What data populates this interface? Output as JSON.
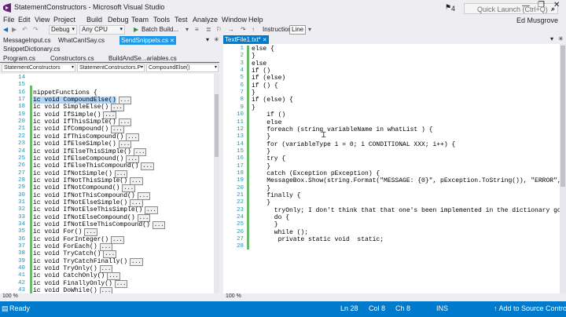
{
  "window": {
    "title": "StatementConstructors - Microsoft Visual Studio",
    "notification_count": "4",
    "quick_launch_placeholder": "Quick Launch (Ctrl+Q)",
    "user": "Ed Musgrove"
  },
  "menu": [
    "File",
    "Edit",
    "View",
    "Project",
    "Build",
    "Debug",
    "Team",
    "Tools",
    "Test",
    "Analyze",
    "Window",
    "Help"
  ],
  "toolbar": {
    "config": "Debug",
    "platform": "Any CPU",
    "batch_build": "Batch Build...",
    "instruction": "Instruction",
    "line": "Line"
  },
  "tabs_row1": [
    {
      "label": "MessageInput.cs"
    },
    {
      "label": "WhatCanISay.cs"
    },
    {
      "label": "SendSnippets.cs"
    }
  ],
  "tabs_row2": [
    {
      "label": "SnippetDictionary.cs"
    }
  ],
  "tabs_row3": [
    {
      "label": "Program.cs"
    },
    {
      "label": "Constructors.cs"
    },
    {
      "label": "BuildAndSe...ariables.cs"
    }
  ],
  "right_tab": {
    "label": "TextFile1.txt*"
  },
  "left_nav": {
    "project": "StatementConstructors",
    "class": "StatementConstructors.P",
    "member": "CompoundElse()"
  },
  "left_code": [
    {
      "n": "14",
      "text": "",
      "tag": ""
    },
    {
      "n": "15",
      "text": "",
      "tag": ""
    },
    {
      "n": "16",
      "text": "nippetFunctions {",
      "tag": ""
    },
    {
      "n": "17",
      "text": "ic void CompoundElse()",
      "tag": "..."
    },
    {
      "n": "18",
      "text": "ic void SimpleElse()",
      "tag": "..."
    },
    {
      "n": "19",
      "text": "ic void IfSimple()",
      "tag": "..."
    },
    {
      "n": "20",
      "text": "ic void IfThisSimple()",
      "tag": "..."
    },
    {
      "n": "21",
      "text": "ic void IfCompound()",
      "tag": "..."
    },
    {
      "n": "22",
      "text": "ic void IfThisCompound()",
      "tag": "..."
    },
    {
      "n": "23",
      "text": "ic void IfElseSimple()",
      "tag": "..."
    },
    {
      "n": "24",
      "text": "ic void IfElseThisSimple()",
      "tag": "..."
    },
    {
      "n": "25",
      "text": "ic void IfElseCompound()",
      "tag": "..."
    },
    {
      "n": "26",
      "text": "ic void IfElseThisCompound()",
      "tag": "..."
    },
    {
      "n": "27",
      "text": "ic void IfNotSimple()",
      "tag": "..."
    },
    {
      "n": "28",
      "text": "ic void IfNotThisSimple()",
      "tag": "..."
    },
    {
      "n": "29",
      "text": "ic void IfNotCompound()",
      "tag": "..."
    },
    {
      "n": "30",
      "text": "ic void IfNotThisCompound()",
      "tag": "..."
    },
    {
      "n": "31",
      "text": "ic void IfNotElseSimple()",
      "tag": "..."
    },
    {
      "n": "32",
      "text": "ic void IfNotElseThisSimple()",
      "tag": "..."
    },
    {
      "n": "33",
      "text": "ic void IfNotElseCompound()",
      "tag": "..."
    },
    {
      "n": "34",
      "text": "ic void IfNotElseThisCompound()",
      "tag": "..."
    },
    {
      "n": "35",
      "text": "ic void For()",
      "tag": "..."
    },
    {
      "n": "36",
      "text": "ic void ForInteger()",
      "tag": "..."
    },
    {
      "n": "37",
      "text": "ic void ForEach()",
      "tag": "..."
    },
    {
      "n": "38",
      "text": "ic void TryCatch()",
      "tag": "..."
    },
    {
      "n": "39",
      "text": "ic void TryCatchFinally()",
      "tag": "..."
    },
    {
      "n": "40",
      "text": "ic void TryOnly()",
      "tag": "..."
    },
    {
      "n": "41",
      "text": "ic void CatchOnly()",
      "tag": "..."
    },
    {
      "n": "42",
      "text": "ic void FinallyOnly()",
      "tag": "..."
    },
    {
      "n": "43",
      "text": "ic void DoWhile()",
      "tag": "..."
    }
  ],
  "right_code": [
    {
      "n": "1",
      "text": "else {"
    },
    {
      "n": "2",
      "text": "}"
    },
    {
      "n": "3",
      "text": "else"
    },
    {
      "n": "4",
      "text": "if ()"
    },
    {
      "n": "5",
      "text": "if (else)"
    },
    {
      "n": "6",
      "text": "if () {"
    },
    {
      "n": "7",
      "text": "}"
    },
    {
      "n": "8",
      "text": "if (else) {"
    },
    {
      "n": "9",
      "text": "}"
    },
    {
      "n": "10",
      "text": "    if ()"
    },
    {
      "n": "11",
      "text": "    else"
    },
    {
      "n": "12",
      "text": "    foreach (string variableName in whatList ) {"
    },
    {
      "n": "13",
      "text": "    }"
    },
    {
      "n": "14",
      "text": "    for (variableType i = 0; i CONDITIONAL XXX; i++) {"
    },
    {
      "n": "15",
      "text": "    }"
    },
    {
      "n": "16",
      "text": "    try {"
    },
    {
      "n": "17",
      "text": "    }"
    },
    {
      "n": "18",
      "text": "    catch (Exception pException) {"
    },
    {
      "n": "19",
      "text": "    MessageBox.Show(string.Format(\"MESSAGE: {0}\", pException.ToString()), \"ERROR\", Mess"
    },
    {
      "n": "20",
      "text": "    }"
    },
    {
      "n": "21",
      "text": "    finally {"
    },
    {
      "n": "22",
      "text": "    }"
    },
    {
      "n": "23",
      "text": "      tryOnly; I don't think that that one's been implemented in the dictionary go to s"
    },
    {
      "n": "24",
      "text": "      do {"
    },
    {
      "n": "25",
      "text": "      }"
    },
    {
      "n": "26",
      "text": "      while ();"
    },
    {
      "n": "27",
      "text": "       private static void  static;"
    },
    {
      "n": "28",
      "text": "      "
    }
  ],
  "zoom": {
    "left": "100 %",
    "right": "100 %"
  },
  "status": {
    "ready": "Ready",
    "ln": "Ln 28",
    "col": "Col 8",
    "ch": "Ch 8",
    "ins": "INS",
    "source_control": "↑ Add to Source Control ▴"
  },
  "colors": {
    "accent": "#007acc",
    "status_bar": "#007acc",
    "selection": "#add6ff",
    "line_numbers": "#2b91af"
  }
}
